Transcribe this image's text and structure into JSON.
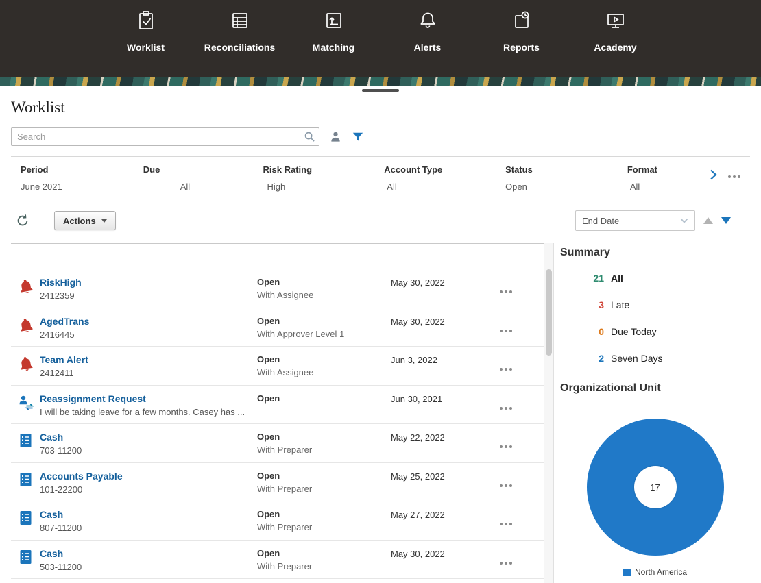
{
  "colors": {
    "nav_background": "#312d2a",
    "accent_blue": "#1b75bb",
    "link_blue": "#15609c",
    "alert_red": "#c4392e",
    "count_all_teal": "#2e8b6f",
    "count_late_red": "#d04437",
    "count_due_today_orange": "#dd7a1c",
    "count_seven_days_blue": "#1b75bb",
    "donut_blue": "#2079c8"
  },
  "nav": {
    "items": [
      {
        "label": "Worklist",
        "icon": "worklist-icon"
      },
      {
        "label": "Reconciliations",
        "icon": "reconciliations-icon"
      },
      {
        "label": "Matching",
        "icon": "matching-icon"
      },
      {
        "label": "Alerts",
        "icon": "alerts-icon"
      },
      {
        "label": "Reports",
        "icon": "reports-icon"
      },
      {
        "label": "Academy",
        "icon": "academy-icon"
      }
    ]
  },
  "page": {
    "title": "Worklist"
  },
  "search": {
    "placeholder": "Search"
  },
  "filters": {
    "items": [
      {
        "label": "Period",
        "value": "June 2021"
      },
      {
        "label": "Due",
        "value": "All"
      },
      {
        "label": "Risk Rating",
        "value": "High"
      },
      {
        "label": "Account Type",
        "value": "All"
      },
      {
        "label": "Status",
        "value": "Open"
      },
      {
        "label": "Format",
        "value": "All"
      }
    ]
  },
  "toolbar": {
    "actions_label": "Actions",
    "sort_field": "End Date"
  },
  "worklist": {
    "rows": [
      {
        "icon": "alert-bell",
        "title": "RiskHigh",
        "subtitle": "2412359",
        "status": "Open",
        "substatus": "With Assignee",
        "date": "May 30, 2022"
      },
      {
        "icon": "alert-bell",
        "title": "AgedTrans",
        "subtitle": "2416445",
        "status": "Open",
        "substatus": "With Approver Level 1",
        "date": "May 30, 2022"
      },
      {
        "icon": "alert-bell",
        "title": "Team Alert",
        "subtitle": "2412411",
        "status": "Open",
        "substatus": "With Assignee",
        "date": "Jun 3, 2022"
      },
      {
        "icon": "reassignment",
        "title": "Reassignment Request",
        "subtitle": "I will be taking leave for a few months. Casey has ...",
        "status": "Open",
        "substatus": "",
        "date": "Jun 30, 2021"
      },
      {
        "icon": "reconciliation",
        "title": "Cash",
        "subtitle": "703-11200",
        "status": "Open",
        "substatus": "With Preparer",
        "date": "May 22, 2022"
      },
      {
        "icon": "reconciliation",
        "title": "Accounts Payable",
        "subtitle": "101-22200",
        "status": "Open",
        "substatus": "With Preparer",
        "date": "May 25, 2022"
      },
      {
        "icon": "reconciliation",
        "title": "Cash",
        "subtitle": "807-11200",
        "status": "Open",
        "substatus": "With Preparer",
        "date": "May 27, 2022"
      },
      {
        "icon": "reconciliation",
        "title": "Cash",
        "subtitle": "503-11200",
        "status": "Open",
        "substatus": "With Preparer",
        "date": "May 30, 2022"
      }
    ]
  },
  "summary": {
    "title": "Summary",
    "items": [
      {
        "count": "21",
        "label": "All",
        "color": "#2e8b6f"
      },
      {
        "count": "3",
        "label": "Late",
        "color": "#d04437"
      },
      {
        "count": "0",
        "label": "Due Today",
        "color": "#dd7a1c"
      },
      {
        "count": "2",
        "label": "Seven Days",
        "color": "#1b75bb"
      }
    ]
  },
  "org_unit": {
    "title": "Organizational Unit"
  },
  "chart_data": {
    "type": "pie",
    "title": "Organizational Unit",
    "center_label": "17",
    "slices": [
      {
        "label": "North America",
        "value": 17,
        "color": "#2079c8"
      }
    ],
    "legend_position": "bottom"
  }
}
